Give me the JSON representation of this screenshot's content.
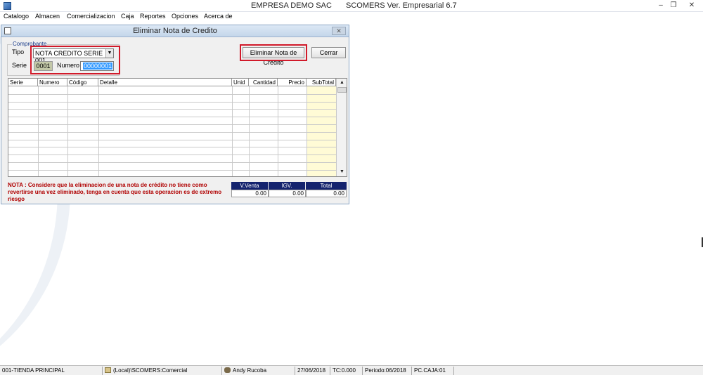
{
  "window": {
    "company": "EMPRESA DEMO SAC",
    "product": "SCOMERS Ver. Empresarial  6.7",
    "minimize": "–",
    "restore": "❐",
    "close": "✕"
  },
  "menu": [
    "Catalogo",
    "Almacen",
    "Comercializacion",
    "Caja",
    "Reportes",
    "Opciones",
    "Acerca de"
  ],
  "dialog": {
    "title": "Eliminar Nota de Credito",
    "close": "✕",
    "group_label": "Comprobante",
    "tipo_label": "Tipo",
    "tipo_value": "NOTA CREDITO SERIE 001",
    "serie_label": "Serie",
    "serie_value": "0001",
    "numero_label": "Numero",
    "numero_value": "00000001",
    "delete_button": "Eliminar Nota de Crédito",
    "close_button": "Cerrar",
    "columns": [
      "Serie",
      "Numero",
      "Código",
      "Detalle",
      "Unid",
      "Cantidad",
      "Precio",
      "SubTotal"
    ],
    "empty_rows": 12,
    "nota": "NOTA : Considere que la eliminacion de una nota de crédito no tiene como revertirse una vez eliminado, tenga en cuenta que esta operacion es de extremo riesgo",
    "totals": {
      "headers": [
        "V.Venta",
        "IGV.",
        "Total"
      ],
      "values": [
        "0.00",
        "0.00",
        "0.00"
      ]
    }
  },
  "status": {
    "store": "001-TIENDA PRINCIPAL",
    "db": "(Local)\\SCOMERS:Comercial",
    "user": "Andy Rucoba",
    "date": "27/06/2018",
    "tc": "TC:0.000",
    "period": "Periodo:06/2018",
    "pc": "PC.CAJA:01"
  },
  "colors": {
    "highlight": "#d11a2a",
    "totals_header": "#14236e",
    "warning_text": "#b00000",
    "subtotal_column": "#fffbd6"
  }
}
